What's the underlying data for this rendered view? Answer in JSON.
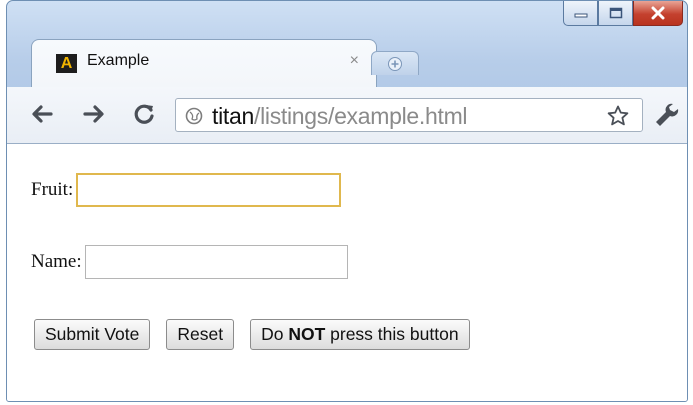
{
  "browser": {
    "tab_title": "Example",
    "tab_close": "×",
    "favicon_letter": "A",
    "url_host": "titan",
    "url_path": "/listings/example.html"
  },
  "form": {
    "fruit_label": "Fruit:",
    "fruit_value": "",
    "name_label": "Name:",
    "name_value": ""
  },
  "buttons": {
    "submit": "Submit Vote",
    "reset": "Reset",
    "danger_prefix": "Do ",
    "danger_strong": "NOT",
    "danger_suffix": " press this button"
  },
  "colors": {
    "focus_border": "#e0b84e",
    "close_button": "#c4412e",
    "frame": "#b7cde9"
  },
  "icons": [
    "minimize-icon",
    "maximize-icon",
    "close-icon",
    "new-tab-icon",
    "back-arrow-icon",
    "forward-arrow-icon",
    "reload-icon",
    "globe-icon",
    "bookmark-star-icon",
    "wrench-icon"
  ]
}
